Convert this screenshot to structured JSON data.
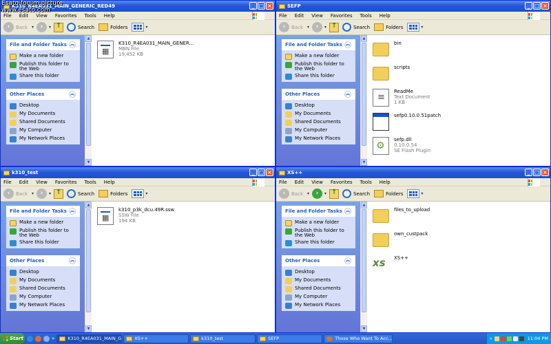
{
  "watermark": {
    "line1": "Esato forum picture",
    "line2": "www.esato.com"
  },
  "menu": [
    "File",
    "Edit",
    "View",
    "Favorites",
    "Tools",
    "Help"
  ],
  "toolbar": {
    "back": "Back",
    "search": "Search",
    "folders": "Folders"
  },
  "tasks": {
    "title": "File and Folder Tasks",
    "items": [
      "Make a new folder",
      "Publish this folder to the Web",
      "Share this folder"
    ]
  },
  "places": {
    "title": "Other Places",
    "items": [
      "Desktop",
      "My Documents",
      "Shared Documents",
      "My Computer",
      "My Network Places"
    ]
  },
  "windows": [
    {
      "title": "K310_R4EA031_MAIN_GENERIC_RED49",
      "files": [
        {
          "name": "K310_R4EA031_MAIN_GENER...",
          "type": "MBN File",
          "size": "19,452 KB",
          "icon": "mbn-file-icon"
        }
      ]
    },
    {
      "title": "SEFP",
      "files": [
        {
          "name": "bin",
          "type": "",
          "size": "",
          "icon": "folder-icon"
        },
        {
          "name": "scripts",
          "type": "",
          "size": "",
          "icon": "folder-icon"
        },
        {
          "name": "ReadMe",
          "type": "Text Document",
          "size": "1 KB",
          "icon": "text-document-icon"
        },
        {
          "name": "sefp0.10.0.51patch",
          "type": "",
          "size": "",
          "icon": "application-icon"
        },
        {
          "name": "sefp.dll",
          "type": "0.10.0.54",
          "size": "SE Flash Plugin",
          "icon": "dll-icon"
        }
      ]
    },
    {
      "title": "k310_test",
      "files": [
        {
          "name": "k310_p3k_dcu.49R.ssw",
          "type": "SSW File",
          "size": "194 KB",
          "icon": "ssw-file-icon"
        }
      ]
    },
    {
      "title": "XS++",
      "files": [
        {
          "name": "files_to_upload",
          "type": "",
          "size": "",
          "icon": "folder-icon"
        },
        {
          "name": "own_custpack",
          "type": "",
          "size": "",
          "icon": "folder-icon"
        },
        {
          "name": "XS++",
          "type": "",
          "size": "",
          "icon": "xs-app-icon"
        }
      ]
    }
  ],
  "taskbar": {
    "start": "Start",
    "tasks": [
      "K310_R4EA031_MAIN_G...",
      "XS++",
      "k310_test",
      "SEFP",
      "Those Who Want To Acc..."
    ],
    "clock": "11:04 PM"
  },
  "colors": {
    "titlebar": "#2457d8",
    "taskpane": "#6f8fe0",
    "taskbar": "#2456c8",
    "tray": "#0f97e8"
  }
}
